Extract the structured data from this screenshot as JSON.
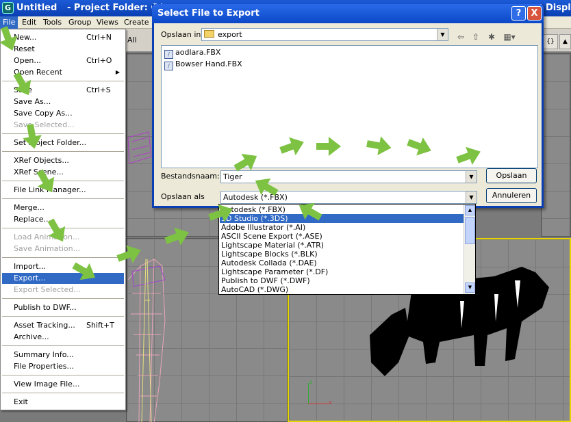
{
  "app": {
    "logo": "3ds Max",
    "title_untitled": "Untitled",
    "title_project": "- Project Folder: C:\\",
    "title_right": "Displa",
    "menus": [
      "File",
      "Edit",
      "Tools",
      "Group",
      "Views",
      "Create"
    ],
    "toolbar_text": "All"
  },
  "file_menu": {
    "items": [
      {
        "label": "New...",
        "shortcut": "Ctrl+N"
      },
      {
        "label": "Reset"
      },
      {
        "label": "Open...",
        "shortcut": "Ctrl+O"
      },
      {
        "label": "Open Recent"
      },
      {
        "label": "Save",
        "shortcut": "Ctrl+S"
      },
      {
        "label": "Save As..."
      },
      {
        "label": "Save Copy As..."
      },
      {
        "label": "Save Selected..."
      },
      {
        "label": "Set Project Folder..."
      },
      {
        "label": "XRef Objects..."
      },
      {
        "label": "XRef Scene..."
      },
      {
        "label": "File Link Manager..."
      },
      {
        "label": "Merge..."
      },
      {
        "label": "Replace..."
      },
      {
        "label": "Load Animation..."
      },
      {
        "label": "Save Animation..."
      },
      {
        "label": "Import..."
      },
      {
        "label": "Export..."
      },
      {
        "label": "Export Selected..."
      },
      {
        "label": "Publish to DWF..."
      },
      {
        "label": "Asset Tracking...",
        "shortcut": "Shift+T"
      },
      {
        "label": "Archive..."
      },
      {
        "label": "Summary Info..."
      },
      {
        "label": "File Properties..."
      },
      {
        "label": "View Image File..."
      },
      {
        "label": "Exit"
      }
    ]
  },
  "dialog": {
    "title": "Select File to Export",
    "save_in_label": "Opslaan in:",
    "save_in_value": "export",
    "files": [
      "aodlara.FBX",
      "Bowser Hand.FBX"
    ],
    "filename_label": "Bestandsnaam:",
    "filename_value": "Tiger",
    "savetype_label": "Opslaan als",
    "savetype_value": "Autodesk (*.FBX)",
    "save_button": "Opslaan",
    "cancel_button": "Annuleren",
    "help_button": "?",
    "close_button": "X"
  },
  "type_list": {
    "items": [
      "Autodesk (*.FBX)",
      "3D Studio (*.3DS)",
      "Adobe Illustrator (*.AI)",
      "ASCII Scene Export (*.ASE)",
      "Lightscape Material (*.ATR)",
      "Lightscape Blocks (*.BLK)",
      "Autodesk Collada (*.DAE)",
      "Lightscape Parameter (*.DF)",
      "Publish to DWF (*.DWF)",
      "AutoCAD (*.DWG)"
    ],
    "selected_index": 1
  },
  "viewport": {
    "axis_z": "z",
    "axis_x": "x"
  },
  "colors": {
    "title_blue": "#0a3fb3",
    "selection_blue": "#316ac5",
    "arrow_green": "#7dc242",
    "viewport_active_border": "#e6d600"
  }
}
